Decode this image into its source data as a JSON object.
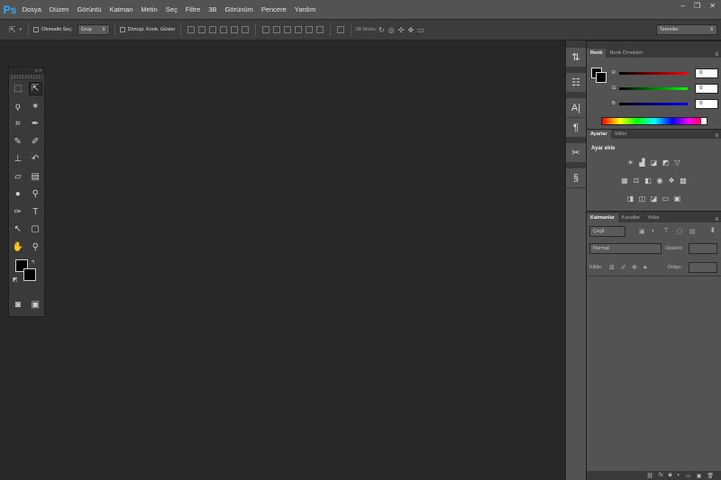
{
  "app": {
    "logo": "Ps"
  },
  "menu": [
    "Dosya",
    "Düzen",
    "Görüntü",
    "Katman",
    "Metin",
    "Seç",
    "Filtre",
    "3B",
    "Görünüm",
    "Pencere",
    "Yardım"
  ],
  "window_controls": [
    "‒",
    "❐",
    "✕"
  ],
  "options": {
    "auto_select_label": "Otomatik Seç:",
    "auto_select_value": "Grup",
    "transform_label": "Dönüşt. Kontr. Göster",
    "mode3d_label": "3B Modu:",
    "workspace": "Temeller"
  },
  "toolbox": {
    "collapse": "«  ×"
  },
  "color_panel": {
    "tabs": [
      "Renk",
      "Renk Örnekleri"
    ],
    "channels": [
      {
        "label": "R",
        "value": "0",
        "track": "linear-gradient(90deg,#000,#f00)"
      },
      {
        "label": "G",
        "value": "0",
        "track": "linear-gradient(90deg,#000,#0f0)"
      },
      {
        "label": "B",
        "value": "0",
        "track": "linear-gradient(90deg,#000,#00f)"
      }
    ]
  },
  "adjustments_panel": {
    "tabs": [
      "Ayarlar",
      "Stiller"
    ],
    "title": "Ayar ekle"
  },
  "layers_panel": {
    "tabs": [
      "Katmanlar",
      "Kanallar",
      "Yollar"
    ],
    "filter": "Çeşit",
    "blend_mode": "Normal",
    "opacity_label": "Opaklık:",
    "lock_label": "Kilitle:",
    "fill_label": "Dolgu:"
  },
  "colors": {
    "accent": "#31a8ff",
    "menubar": "#535353",
    "canvas": "#282828",
    "panel": "#535353"
  }
}
